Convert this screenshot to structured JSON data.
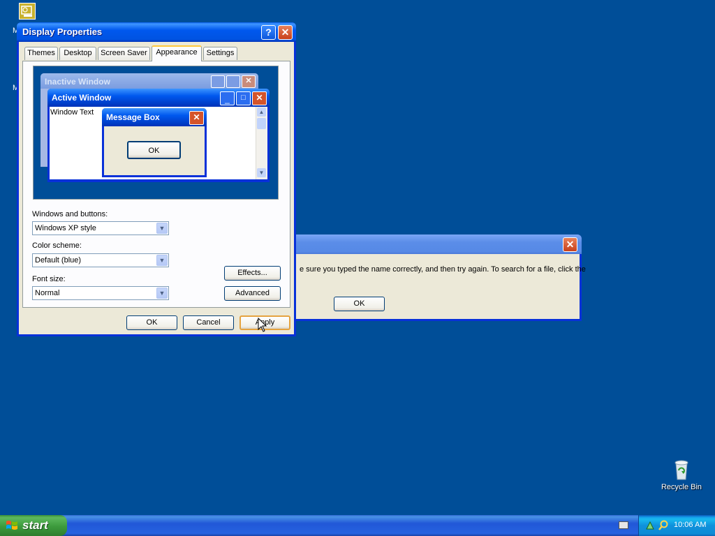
{
  "desktop": {
    "recycle_label": "Recycle Bin",
    "side_letter_1": "M",
    "side_letter_2": "M"
  },
  "error_dialog": {
    "message": "e sure you typed the name correctly, and then try again. To search for a file, click the",
    "ok_label": "OK"
  },
  "display_properties": {
    "title": "Display Properties",
    "tabs": [
      "Themes",
      "Desktop",
      "Screen Saver",
      "Appearance",
      "Settings"
    ],
    "active_tab": "Appearance",
    "preview": {
      "inactive_title": "Inactive Window",
      "active_title": "Active Window",
      "window_text": "Window Text",
      "message_box_title": "Message Box",
      "message_ok": "OK"
    },
    "windows_buttons_label": "Windows and buttons:",
    "windows_buttons_value": "Windows XP style",
    "color_scheme_label": "Color scheme:",
    "color_scheme_value": "Default (blue)",
    "font_size_label": "Font size:",
    "font_size_value": "Normal",
    "effects_label": "Effects...",
    "advanced_label": "Advanced",
    "ok_label": "OK",
    "cancel_label": "Cancel",
    "apply_label": "Apply"
  },
  "taskbar": {
    "start_label": "start",
    "clock": "10:06 AM"
  },
  "colors": {
    "desktop": "#004e98",
    "title_active": "#0058ee",
    "start_green": "#3c9a3c"
  }
}
